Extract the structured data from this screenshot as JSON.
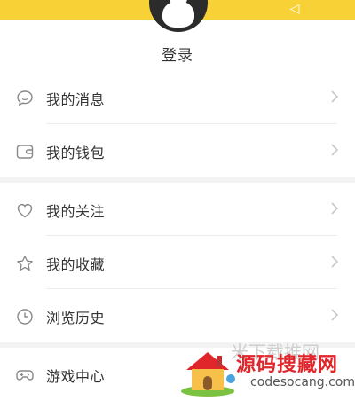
{
  "header": {
    "login_label": "登录",
    "accent_color": "#f7d136",
    "arrow_icon": "share-icon"
  },
  "menu": {
    "group1": [
      {
        "label": "我的消息",
        "icon": "message-icon"
      },
      {
        "label": "我的钱包",
        "icon": "wallet-icon"
      }
    ],
    "group2": [
      {
        "label": "我的关注",
        "icon": "heart-icon"
      },
      {
        "label": "我的收藏",
        "icon": "star-icon"
      },
      {
        "label": "浏览历史",
        "icon": "clock-icon"
      }
    ],
    "group3": [
      {
        "label": "游戏中心",
        "icon": "gamepad-icon"
      }
    ]
  },
  "watermark": {
    "title": "源码搜藏网",
    "url": "codesocang.com",
    "ghost_text": "米下载推网"
  }
}
